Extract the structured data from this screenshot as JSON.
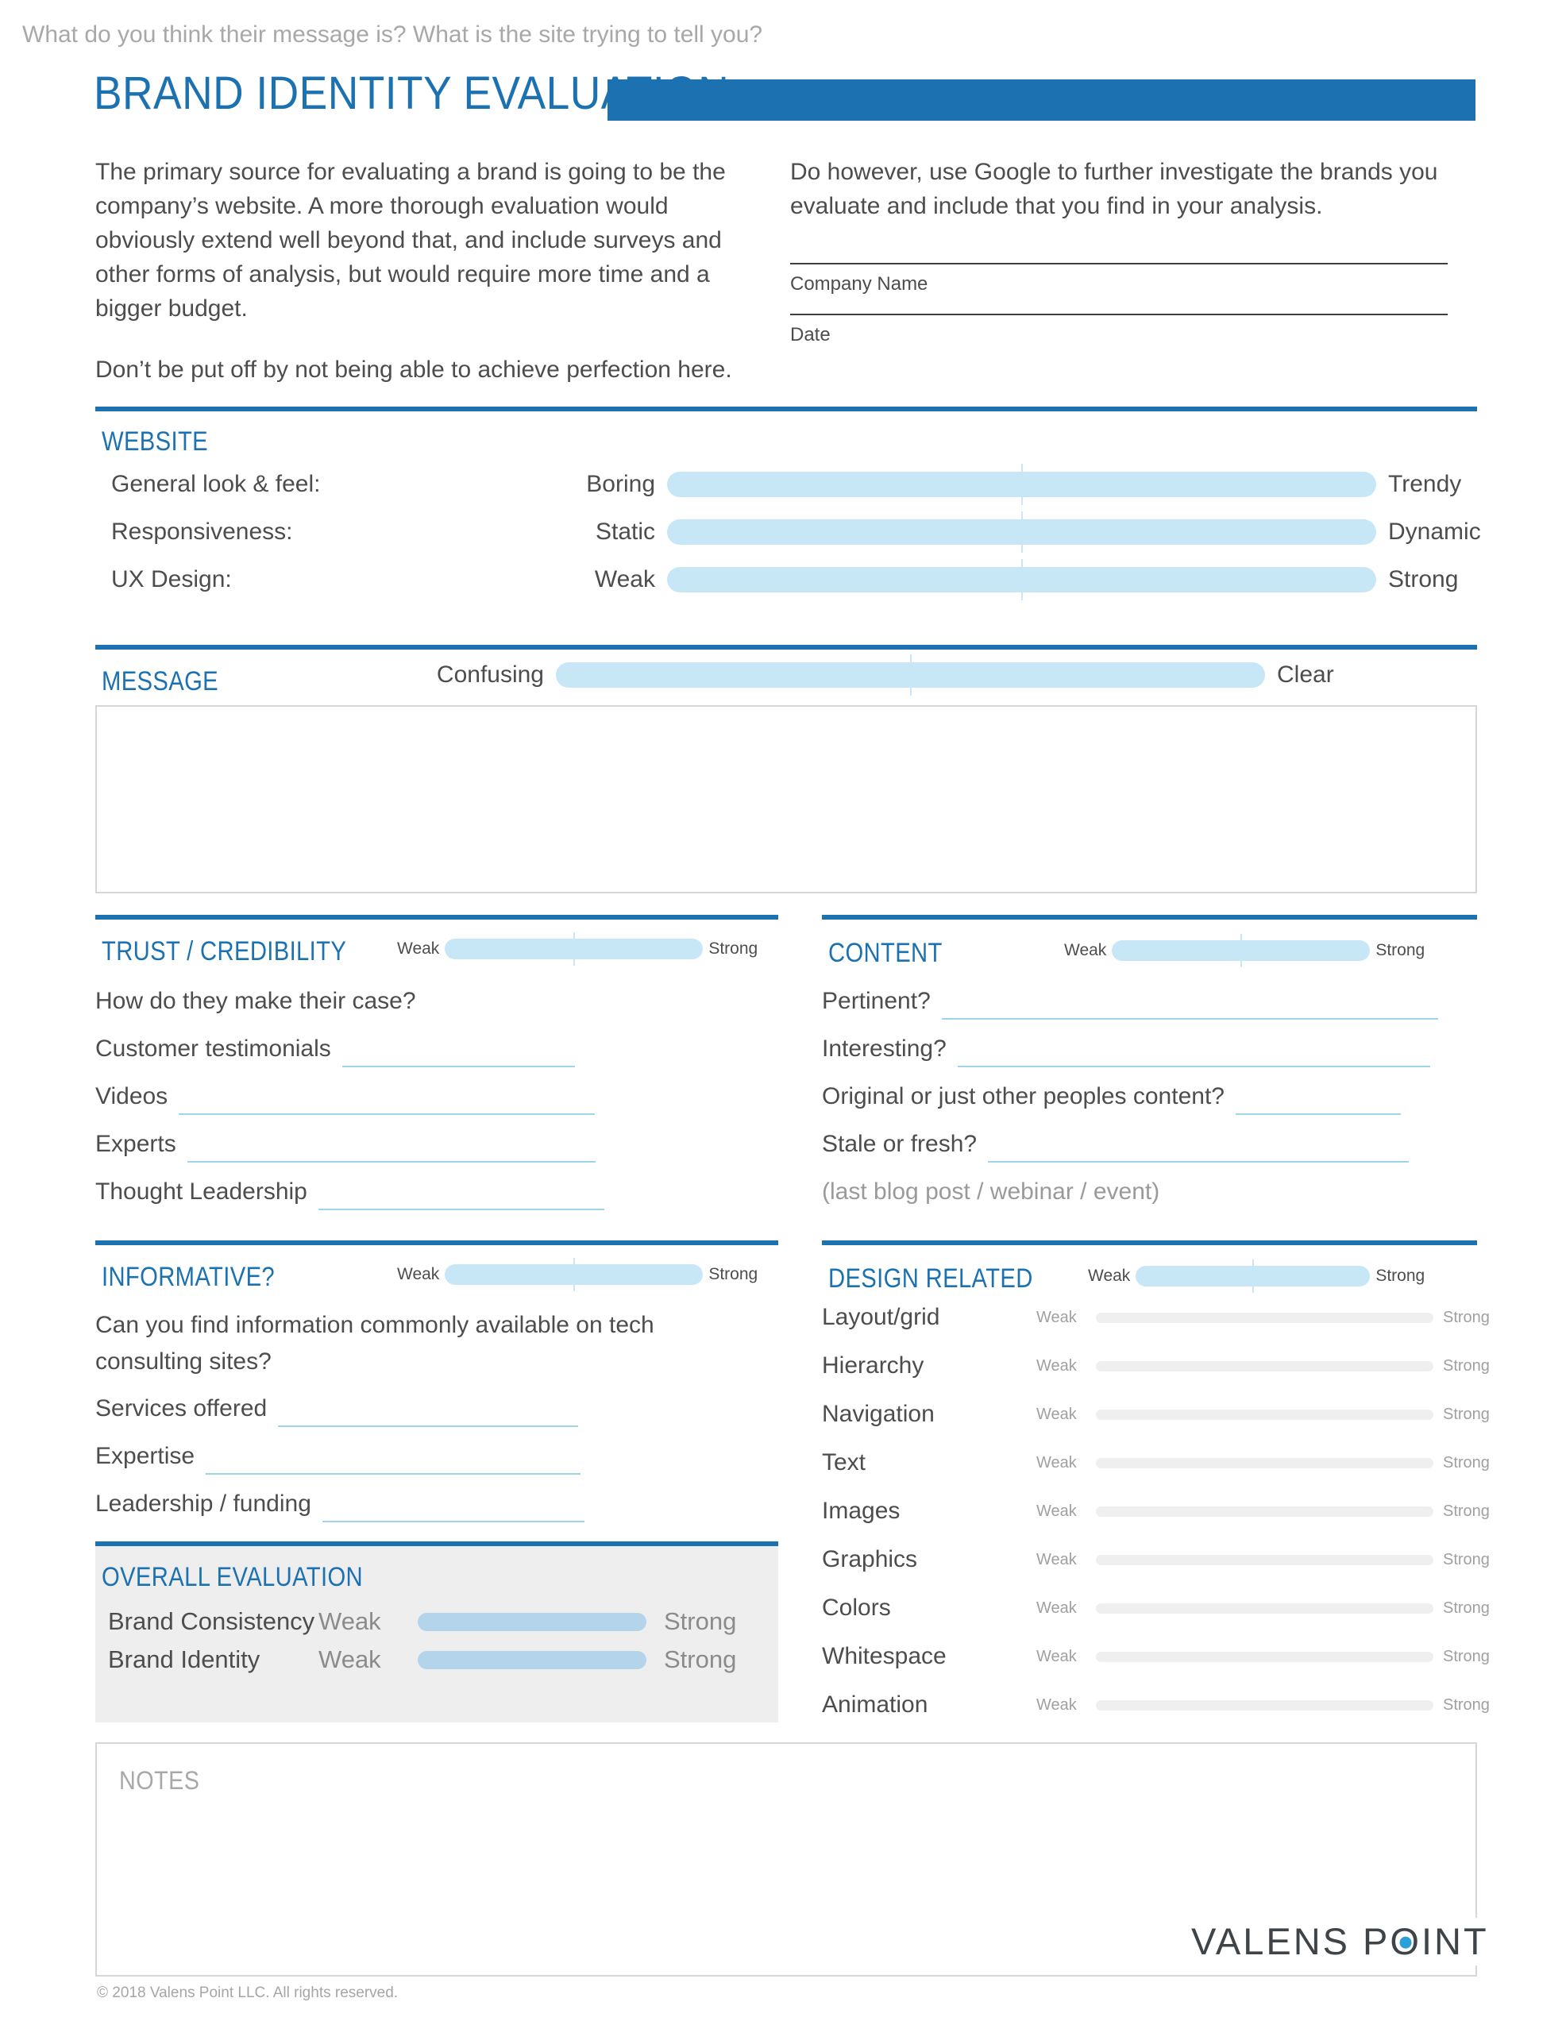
{
  "header": {
    "title": "BRAND IDENTITY EVALUATION",
    "accent_color": "#1c71b0"
  },
  "intro": {
    "left_paragraph_1": "The primary source for evaluating a brand is going to be the company’s website. A more thorough evaluation would obviously extend well beyond that, and include surveys and other forms of analysis, but would require more time and a bigger budget.",
    "left_paragraph_2": "Don’t be put off by not being able to achieve perfection here.",
    "right_paragraph": "Do however, use Google to further investigate the brands you evaluate and include that you find in your analysis.",
    "company_name_label": "Company Name",
    "company_name_value": "",
    "date_label": "Date",
    "date_value": ""
  },
  "website": {
    "title": "WEBSITE",
    "rows": [
      {
        "label": "General look & feel:",
        "left": "Boring",
        "right": "Trendy"
      },
      {
        "label": "Responsiveness:",
        "left": "Static",
        "right": "Dynamic"
      },
      {
        "label": "UX Design:",
        "left": "Weak",
        "right": "Strong"
      }
    ]
  },
  "message": {
    "title": "MESSAGE",
    "scale_left": "Confusing",
    "scale_right": "Clear",
    "placeholder": "What do you think their message is? What is the site trying to tell you?",
    "value": ""
  },
  "trust": {
    "title": "TRUST / CREDIBILITY",
    "scale_left": "Weak",
    "scale_right": "Strong",
    "prompt": "How do they make their case?",
    "rows": [
      {
        "label": "Customer testimonials",
        "value": ""
      },
      {
        "label": "Videos",
        "value": ""
      },
      {
        "label": "Experts",
        "value": ""
      },
      {
        "label": "Thought Leadership",
        "value": ""
      }
    ]
  },
  "content": {
    "title": "CONTENT",
    "scale_left": "Weak",
    "scale_right": "Strong",
    "rows": [
      {
        "label": "Pertinent?",
        "value": ""
      },
      {
        "label": "Interesting?",
        "value": ""
      },
      {
        "label": "Original or just other peoples content?",
        "value": ""
      },
      {
        "label": "Stale or fresh?",
        "value": ""
      }
    ],
    "hint": "(last blog post / webinar / event)"
  },
  "informative": {
    "title": "INFORMATIVE?",
    "scale_left": "Weak",
    "scale_right": "Strong",
    "prompt": "Can you find information commonly available on tech consulting sites?",
    "rows": [
      {
        "label": "Services offered",
        "value": ""
      },
      {
        "label": "Expertise",
        "value": ""
      },
      {
        "label": "Leadership / funding",
        "value": ""
      }
    ]
  },
  "design_related": {
    "title": "DESIGN RELATED",
    "scale_left": "Weak",
    "scale_right": "Strong",
    "rows": [
      {
        "label": "Layout/grid",
        "left": "Weak",
        "right": "Strong"
      },
      {
        "label": "Hierarchy",
        "left": "Weak",
        "right": "Strong"
      },
      {
        "label": "Navigation",
        "left": "Weak",
        "right": "Strong"
      },
      {
        "label": "Text",
        "left": "Weak",
        "right": "Strong"
      },
      {
        "label": "Images",
        "left": "Weak",
        "right": "Strong"
      },
      {
        "label": "Graphics",
        "left": "Weak",
        "right": "Strong"
      },
      {
        "label": "Colors",
        "left": "Weak",
        "right": "Strong"
      },
      {
        "label": "Whitespace",
        "left": "Weak",
        "right": "Strong"
      },
      {
        "label": "Animation",
        "left": "Weak",
        "right": "Strong"
      }
    ]
  },
  "overall": {
    "title": "OVERALL EVALUATION",
    "rows": [
      {
        "label": "Brand Consistency",
        "left": "Weak",
        "right": "Strong"
      },
      {
        "label": "Brand Identity",
        "left": "Weak",
        "right": "Strong"
      }
    ]
  },
  "notes": {
    "label": "NOTES",
    "value": ""
  },
  "footer": {
    "logo_part1": "VALENS P",
    "logo_o": "O",
    "logo_part2": "INT",
    "logo_dot_color": "#2a9fd8",
    "copyright": "© 2018 Valens Point LLC. All rights reserved."
  }
}
